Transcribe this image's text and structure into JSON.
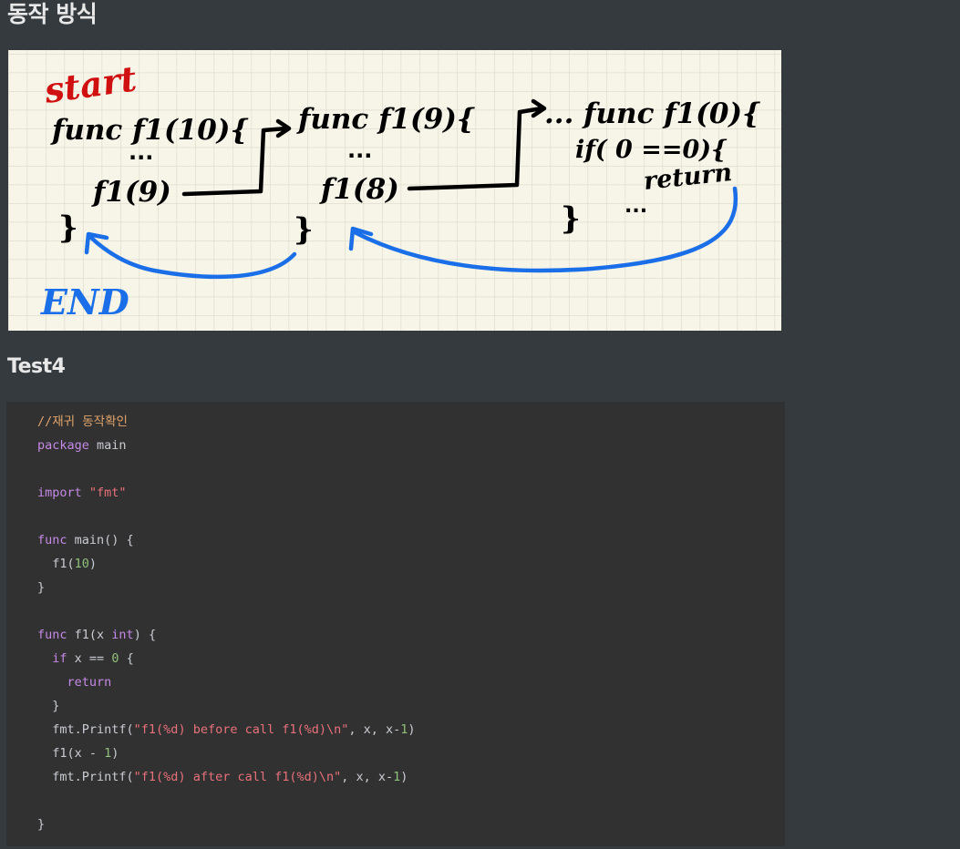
{
  "heading": "동작 방식",
  "sketch": {
    "start_label": "start",
    "end_label": "END",
    "frame1": {
      "sig": "func f1(10){",
      "dots": "...",
      "call": "f1(9)",
      "close": "}"
    },
    "frame2": {
      "sig": "func f1(9){",
      "dots": "...",
      "call": "f1(8)",
      "close": "}"
    },
    "frame3": {
      "sig": "... func f1(0){",
      "cond": "if( 0 ==0){",
      "ret": "return",
      "dots": "...",
      "close": "}"
    },
    "colors": {
      "ink": "#000000",
      "start": "#d01010",
      "return_arrows": "#1a6fe8",
      "paper": "#f7f4e8",
      "grid": "#e0ddcf"
    }
  },
  "subheading": "Test4",
  "code": {
    "lines": [
      [
        {
          "t": "//재귀 동작확인",
          "c": "comment"
        }
      ],
      [
        {
          "t": "package",
          "c": "kw"
        },
        {
          "t": " main",
          "c": "plain"
        }
      ],
      [],
      [
        {
          "t": "import",
          "c": "kw"
        },
        {
          "t": " ",
          "c": "plain"
        },
        {
          "t": "\"fmt\"",
          "c": "str"
        }
      ],
      [],
      [
        {
          "t": "func",
          "c": "kw"
        },
        {
          "t": " main() {",
          "c": "plain"
        }
      ],
      [
        {
          "t": "  f1(",
          "c": "plain"
        },
        {
          "t": "10",
          "c": "num"
        },
        {
          "t": ")",
          "c": "plain"
        }
      ],
      [
        {
          "t": "}",
          "c": "plain"
        }
      ],
      [],
      [
        {
          "t": "func",
          "c": "kw"
        },
        {
          "t": " f1(x ",
          "c": "plain"
        },
        {
          "t": "int",
          "c": "kw"
        },
        {
          "t": ") {",
          "c": "plain"
        }
      ],
      [
        {
          "t": "  ",
          "c": "plain"
        },
        {
          "t": "if",
          "c": "kw"
        },
        {
          "t": " x == ",
          "c": "plain"
        },
        {
          "t": "0",
          "c": "num"
        },
        {
          "t": " {",
          "c": "plain"
        }
      ],
      [
        {
          "t": "    ",
          "c": "plain"
        },
        {
          "t": "return",
          "c": "kw"
        }
      ],
      [
        {
          "t": "  }",
          "c": "plain"
        }
      ],
      [
        {
          "t": "  fmt.Printf(",
          "c": "plain"
        },
        {
          "t": "\"f1(%d) before call f1(%d)\\n\"",
          "c": "str"
        },
        {
          "t": ", x, x-",
          "c": "plain"
        },
        {
          "t": "1",
          "c": "num"
        },
        {
          "t": ")",
          "c": "plain"
        }
      ],
      [
        {
          "t": "  f1(x - ",
          "c": "plain"
        },
        {
          "t": "1",
          "c": "num"
        },
        {
          "t": ")",
          "c": "plain"
        }
      ],
      [
        {
          "t": "  fmt.Printf(",
          "c": "plain"
        },
        {
          "t": "\"f1(%d) after call f1(%d)\\n\"",
          "c": "str"
        },
        {
          "t": ", x, x-",
          "c": "plain"
        },
        {
          "t": "1",
          "c": "num"
        },
        {
          "t": ")",
          "c": "plain"
        }
      ],
      [],
      [
        {
          "t": "}",
          "c": "plain"
        }
      ]
    ]
  }
}
